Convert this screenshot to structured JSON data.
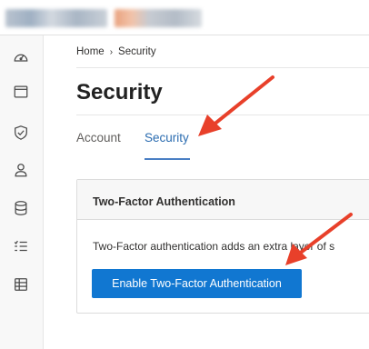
{
  "icons": {
    "sidebar": [
      "dashboard-icon",
      "window-icon",
      "shield-check-icon",
      "user-icon",
      "database-icon",
      "checklist-icon",
      "server-icon"
    ]
  },
  "breadcrumb": {
    "home": "Home",
    "separator": "›",
    "current": "Security"
  },
  "page": {
    "title": "Security"
  },
  "tabs": [
    {
      "label": "Account",
      "active": false
    },
    {
      "label": "Security",
      "active": true
    }
  ],
  "card": {
    "title": "Two-Factor Authentication",
    "description": "Two-Factor authentication adds an extra layer of s",
    "button_label": "Enable Two-Factor Authentication"
  },
  "colors": {
    "accent": "#1177d1",
    "active_tab": "#2b6cb0",
    "annotation_arrow": "#e8402a"
  }
}
